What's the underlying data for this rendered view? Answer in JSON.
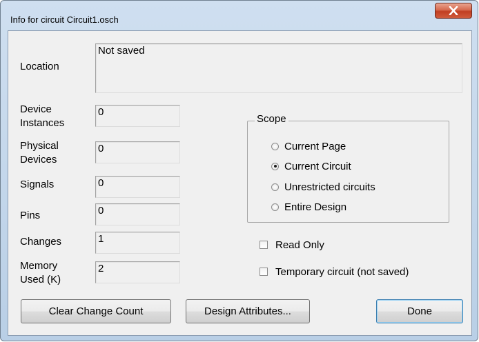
{
  "window": {
    "title": "Info for circuit Circuit1.osch"
  },
  "location": {
    "label": "Location",
    "value": "Not saved"
  },
  "stats": [
    {
      "label": "Device\nInstances",
      "value": "0"
    },
    {
      "label": "Physical\nDevices",
      "value": "0"
    },
    {
      "label": "Signals",
      "value": "0"
    },
    {
      "label": "Pins",
      "value": "0"
    },
    {
      "label": "Changes",
      "value": "1"
    },
    {
      "label": "Memory\nUsed (K)",
      "value": "2"
    }
  ],
  "scope": {
    "title": "Scope",
    "options": [
      {
        "label": "Current Page",
        "selected": false
      },
      {
        "label": "Current Circuit",
        "selected": true
      },
      {
        "label": "Unrestricted circuits",
        "selected": false
      },
      {
        "label": "Entire Design",
        "selected": false
      }
    ]
  },
  "checkboxes": [
    {
      "label": "Read Only",
      "checked": false
    },
    {
      "label": "Temporary circuit (not saved)",
      "checked": false
    }
  ],
  "buttons": {
    "clear": "Clear Change Count",
    "attributes": "Design Attributes...",
    "done": "Done"
  }
}
